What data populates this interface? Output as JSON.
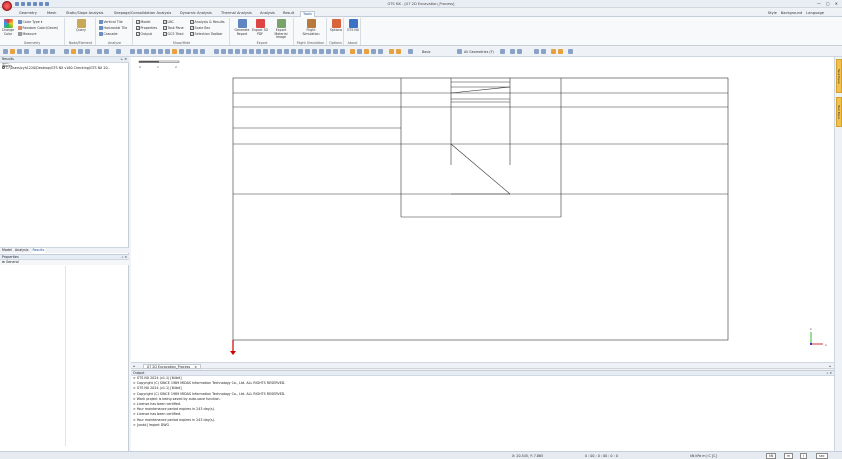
{
  "window": {
    "title": "GTS NX - [07 2D Excavation_Process]",
    "controls": [
      "—",
      "▢",
      "✕"
    ]
  },
  "menu": {
    "tabs": [
      "Geometry",
      "Mesh",
      "Static/Slope Analysis",
      "Seepage/Consolidation Analysis",
      "Dynamic Analysis",
      "Thermal Analysis",
      "Analysis",
      "Result",
      "Tools"
    ],
    "active": "Tools",
    "right": [
      "Style",
      "Background",
      "Language"
    ]
  },
  "ribbon": {
    "groups": [
      {
        "label": "Geometry"
      },
      {
        "label": "Node/Element"
      },
      {
        "label": "Analyze"
      },
      {
        "label": "Show/Hide"
      },
      {
        "label": "Export"
      },
      {
        "label": "Flight Simulation"
      },
      {
        "label": "Options"
      },
      {
        "label": "About"
      }
    ],
    "geometry": {
      "change_color": "Change Color",
      "color_type": "Color Type",
      "random_color": "Random Color(Geom)",
      "measure": "Measure"
    },
    "node_element": {
      "query": "Query"
    },
    "analyze": {
      "vertical_tile": "Vertical Tile",
      "horizontal_tile": "Horizontal Tile",
      "cascade": "Cascade"
    },
    "show_hide": {
      "model": "Model",
      "lbc": "LBC",
      "analysis_results": "Analysis & Results",
      "properties": "Properties",
      "task_pane": "Task Pane",
      "scale_bar": "Scale Bar",
      "output": "Output",
      "gcs_triad": "GCS Triad",
      "selection_toolbar": "Selection Toolbar"
    },
    "export": {
      "generate_report": "Generate Report",
      "export_3d_pdf": "Export 3D PDF",
      "export_material_image": "Export Material Image"
    },
    "flight": {
      "flight_simulation": "Flight Simulation"
    },
    "options": {
      "options": "Options"
    },
    "about": {
      "gts_nx": "GTS NX"
    }
  },
  "toolbar": {
    "view_label": "Basic",
    "filter_label": "All Geometries (F)"
  },
  "left_panel": {
    "works_title": "Works",
    "tree_root": "Item",
    "tree_path": "C:\\Users\\cyh1220\\Desktop\\GTS NX v160 Checking\\GTS NX 20..",
    "results_title": "Results",
    "bottom_tabs": [
      "Model",
      "Analysis",
      "Results"
    ],
    "active_tab": "Results",
    "properties_title": "Properties",
    "properties_group": "General"
  },
  "viewport": {
    "scale_labels": [
      "0",
      "1",
      "2"
    ]
  },
  "doc_tab": {
    "label": "07 2D Excavation_Process"
  },
  "output": {
    "title": "Output",
    "lines": [
      "> GTS NX 2024 (v1.1) [64bit]",
      "> Copyright (C) SINCE 1989 MIDAS Information Technology Co., Ltd. ALL RIGHTS RESERVED.",
      "> GTS NX 2024 (v1.1) [64bit]",
      "> Copyright (C) SINCE 1989 MIDAS Information Technology Co., Ltd. ALL RIGHTS RESERVED.",
      "> Work project is being saved by auto-save function.",
      "> License has been certified.",
      "> Your maintenance period expires in 243 day(s).",
      "> License has been certified.",
      "> Your maintenance period expires in 243 day(s).",
      "> [undo] Import DWG"
    ]
  },
  "side_tabs": [
    "Task Pane",
    "Tool Pane"
  ],
  "status": {
    "coords": "X: 20.545, Y: 7.865",
    "zero": "0 : 00 : 0 : 00 : 0 : 0",
    "units": "kN  kPa  m  J  C  [C]",
    "unit_force": "kN",
    "unit_length": "m",
    "unit_temp": "J",
    "unit_time": "sec"
  }
}
